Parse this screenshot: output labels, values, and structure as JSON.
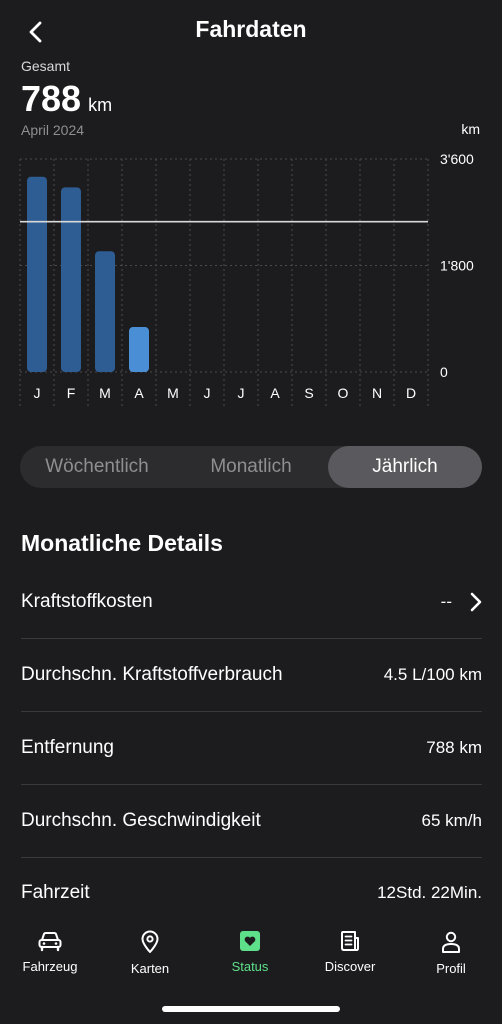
{
  "header": {
    "title": "Fahrdaten"
  },
  "summary": {
    "label": "Gesamt",
    "value": "788",
    "unit": "km",
    "period": "April 2024"
  },
  "chart_data": {
    "type": "bar",
    "unit_label": "km",
    "categories": [
      "J",
      "F",
      "M",
      "A",
      "M",
      "J",
      "J",
      "A",
      "S",
      "O",
      "N",
      "D"
    ],
    "values": [
      3300,
      3120,
      2040,
      760,
      0,
      0,
      0,
      0,
      0,
      0,
      0,
      0
    ],
    "highlighted_index": 3,
    "reference_line": 2540,
    "ylim": [
      0,
      3600
    ],
    "y_tick_values": [
      0,
      1800,
      3600
    ],
    "y_ticks": [
      "0",
      "1'800",
      "3'600"
    ],
    "grid": true,
    "colors": {
      "bar": "#2e5d94",
      "highlight": "#4a8fd6",
      "reference": "#d9d9d9",
      "grid": "#4a4a4c"
    }
  },
  "segments": {
    "items": [
      "Wöchentlich",
      "Monatlich",
      "Jährlich"
    ],
    "active_index": 2
  },
  "details": {
    "title": "Monatliche Details",
    "rows": [
      {
        "label": "Kraftstoffkosten",
        "value": "--"
      },
      {
        "label": "Durchschn. Kraftstoffverbrauch",
        "value": "4.5 L/100 km"
      },
      {
        "label": "Entfernung",
        "value": "788 km"
      },
      {
        "label": "Durchschn. Geschwindigkeit",
        "value": "65 km/h"
      },
      {
        "label": "Fahrzeit",
        "value": "12Std. 22Min."
      }
    ]
  },
  "tabbar": {
    "items": [
      {
        "label": "Fahrzeug",
        "icon": "car-icon"
      },
      {
        "label": "Karten",
        "icon": "map-pin-icon"
      },
      {
        "label": "Status",
        "icon": "heart-icon"
      },
      {
        "label": "Discover",
        "icon": "news-icon"
      },
      {
        "label": "Profil",
        "icon": "person-icon"
      }
    ],
    "active_index": 2,
    "colors": {
      "active": "#5ee08a",
      "inactive": "#ffffff"
    }
  }
}
